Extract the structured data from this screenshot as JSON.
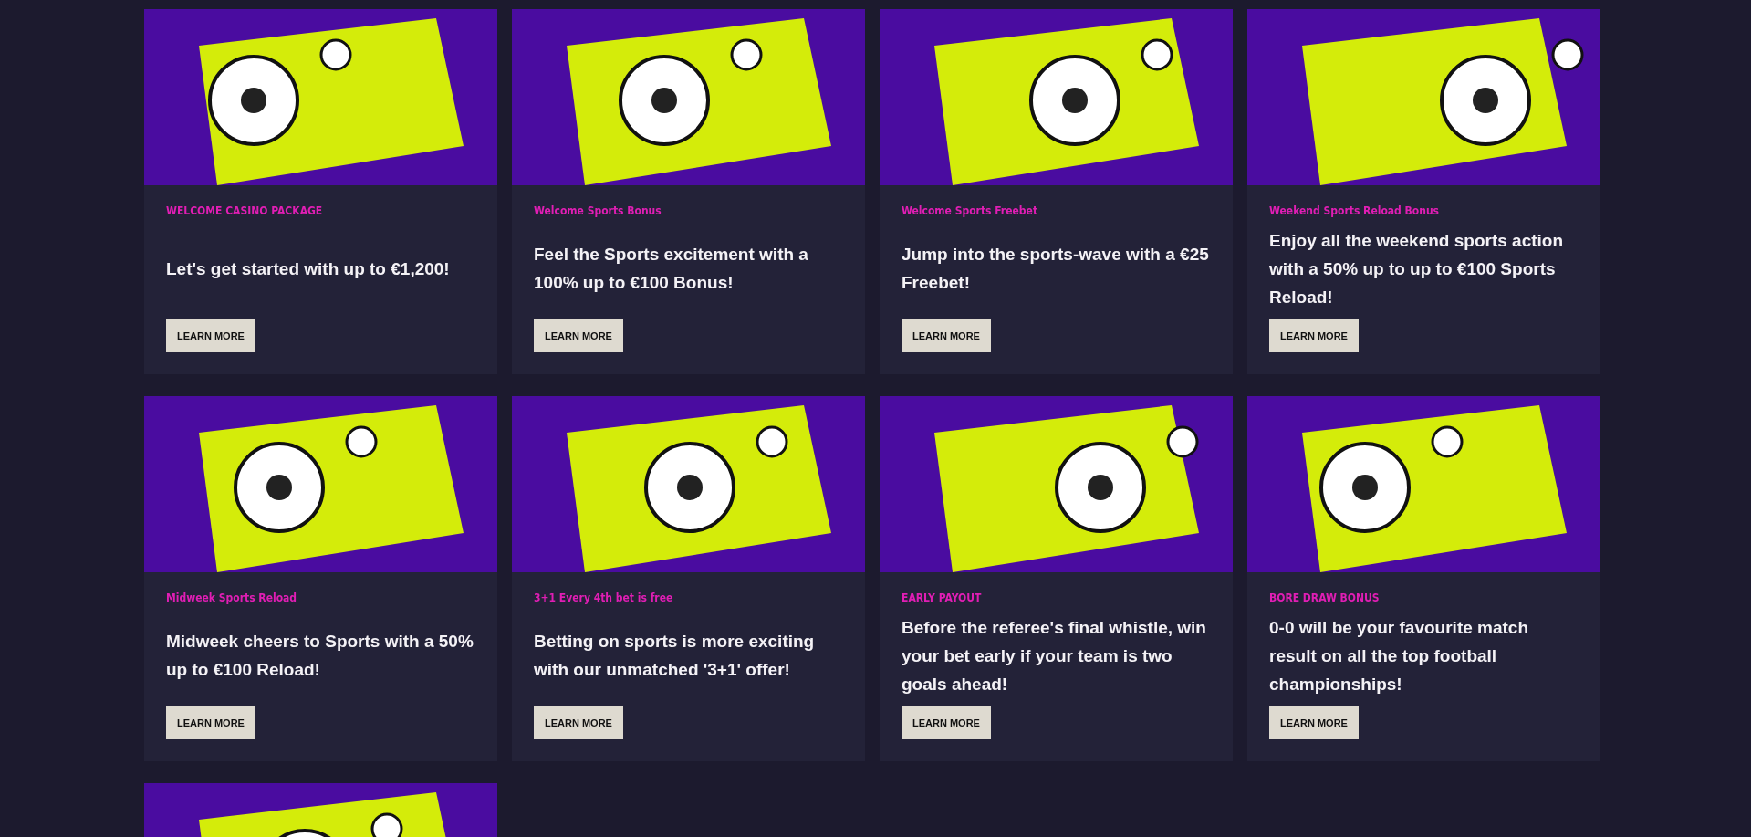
{
  "cards": [
    {
      "kind": "offer",
      "label": "WELCOME CASINO PACKAGE",
      "title": "Let's get started with up to €1,200!",
      "button": "LEARN MORE"
    },
    {
      "kind": "offer",
      "label": "Welcome Sports Bonus",
      "title": "Feel the Sports excitement with a 100% up to €100 Bonus!",
      "button": "LEARN MORE"
    },
    {
      "kind": "offer",
      "label": "Welcome Sports Freebet",
      "title": "Jump into the sports-wave with a €25 Freebet!",
      "button": "LEARN MORE"
    },
    {
      "kind": "offer",
      "label": "Weekend Sports Reload Bonus",
      "title": "Enjoy all the weekend sports action with a 50% up to up to €100 Sports Reload!",
      "button": "LEARN MORE"
    },
    {
      "kind": "offer",
      "label": "Midweek Sports Reload",
      "title": "Midweek cheers to Sports with a 50% up to €100 Reload!",
      "button": "LEARN MORE"
    },
    {
      "kind": "offer",
      "label": "3+1 Every 4th bet is free",
      "title": "Betting on sports is more exciting with our unmatched '3+1' offer!",
      "button": "LEARN MORE"
    },
    {
      "kind": "offer",
      "label": "EARLY PAYOUT",
      "title": "Before the referee's final whistle, win your bet early if your team is two goals ahead!",
      "button": "LEARN MORE"
    },
    {
      "kind": "offer",
      "label": "BORE DRAW BONUS",
      "title": "0-0 will be your favourite match result on all the top football championships!",
      "button": "LEARN MORE"
    },
    {
      "kind": "image_only"
    }
  ]
}
